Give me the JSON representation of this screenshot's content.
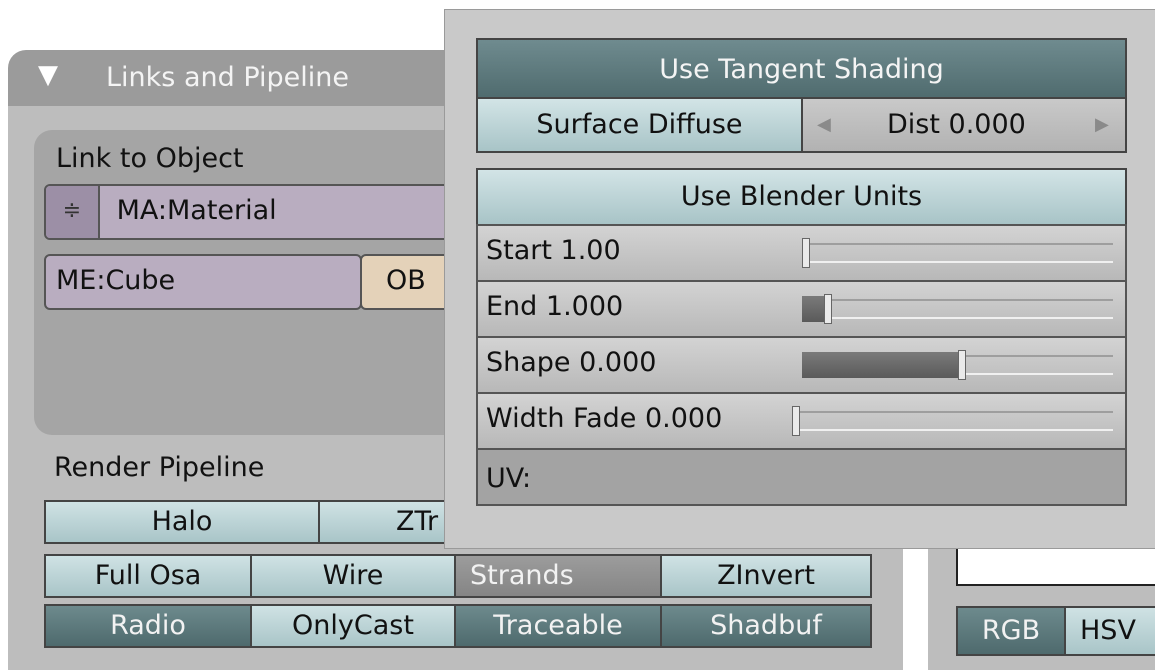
{
  "panel": {
    "title": "Links and Pipeline",
    "collapse_glyph": "▼",
    "link_to_object_label": "Link to Object",
    "material_field": "MA:Material",
    "material_arrows_glyph": "≑",
    "mesh_field": "ME:Cube",
    "ob_button": "OB",
    "render_pipeline_label": "Render Pipeline",
    "pipeline_row1": [
      "Halo",
      "ZTr"
    ],
    "pipeline_row2": [
      "Full Osa",
      "Wire",
      "Strands",
      "ZInvert"
    ],
    "pipeline_row3": [
      "Radio",
      "OnlyCast",
      "Traceable",
      "Shadbuf"
    ]
  },
  "right_panel": {
    "color_modes": [
      "RGB",
      "HSV"
    ]
  },
  "popup": {
    "tangent_button": "Use Tangent Shading",
    "surface_diffuse_button": "Surface Diffuse",
    "dist_field": "Dist 0.000",
    "blender_units_button": "Use Blender Units",
    "sliders": [
      {
        "label": "Start 1.00",
        "value": 0.0
      },
      {
        "label": "End 1.000",
        "value": 0.07
      },
      {
        "label": "Shape 0.000",
        "value": 0.5
      },
      {
        "label": "Width Fade 0.000",
        "value": 0.0
      }
    ],
    "uv_label": "UV:"
  },
  "colors": {
    "button_on": "#4f6b6e",
    "button_off": "#a8c4c7",
    "field_purple": "#b9adc0",
    "panel_bg": "#bdbdbd"
  }
}
